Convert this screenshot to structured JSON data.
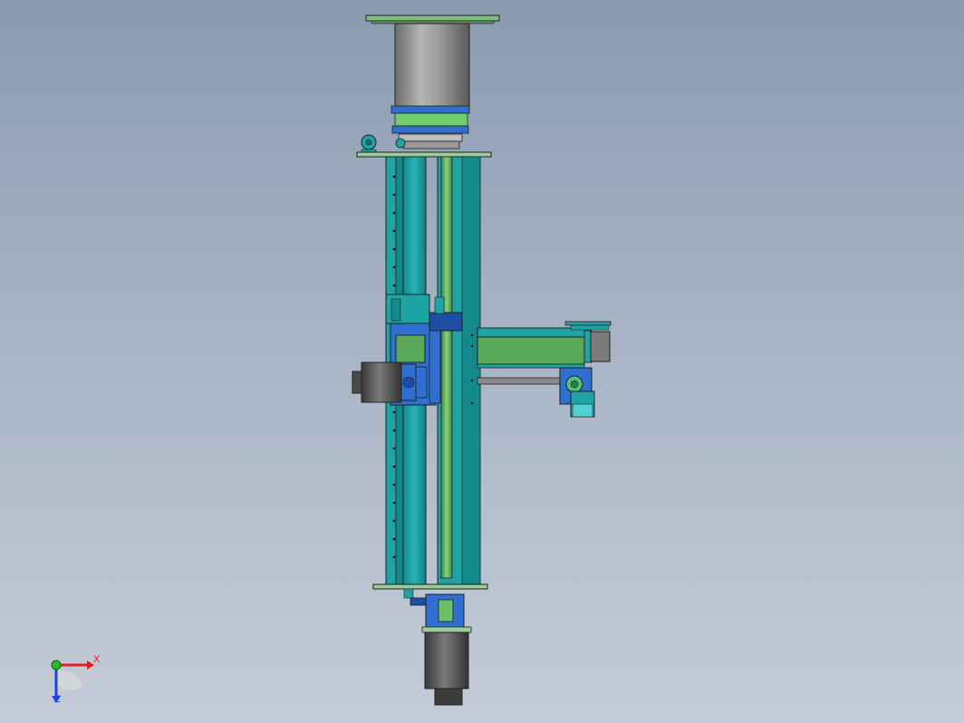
{
  "view": {
    "background_top": "#8a9bb0",
    "background_bottom": "#c5ccd7"
  },
  "model": {
    "description_icon": "cad-assembly",
    "colors": {
      "teal": "#1fa4a6",
      "teal_dark": "#117d80",
      "green": "#6bbf6b",
      "green_dark": "#4c9c54",
      "gray": "#8e8e8e",
      "gray_dark": "#4a4a4a",
      "blue": "#2f6fd0",
      "blue_dark": "#1c4ea3",
      "edge": "#1a1a1a"
    }
  },
  "triad": {
    "x_label": "X",
    "z_label": "Z",
    "x_color": "#e02020",
    "y_color": "#20c020",
    "z_color": "#2040e0"
  }
}
